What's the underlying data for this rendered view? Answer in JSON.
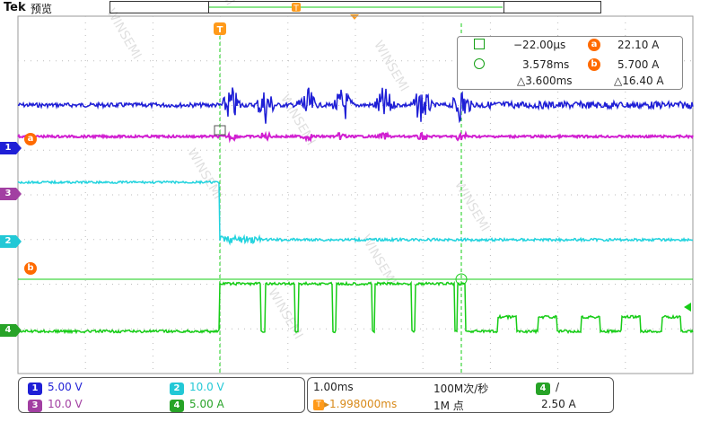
{
  "header": {
    "brand": "Tek",
    "mode": "预览",
    "trigger_marker": "T"
  },
  "colors": {
    "ch1": "#1f1fd6",
    "ch2": "#22d3de",
    "ch3": "#d11fd1",
    "ch4": "#16cc16",
    "cursor": "#ff6a00",
    "graticule": "#c8c8c8"
  },
  "channel_markers": [
    {
      "label": "1",
      "color": "#1f1fd6"
    },
    {
      "label": "3",
      "color": "#a23fa2"
    },
    {
      "label": "2",
      "color": "#22c8d6"
    },
    {
      "label": "4",
      "color": "#27a327"
    }
  ],
  "cursor_labels": {
    "a": "a",
    "b": "b"
  },
  "readout": {
    "cursor1_time": "−22.00μs",
    "cursor1_value_label": "a",
    "cursor1_value": "22.10 A",
    "cursor2_time": "3.578ms",
    "cursor2_value_label": "b",
    "cursor2_value": "5.700 A",
    "delta_time": "△3.600ms",
    "delta_value": "△16.40 A"
  },
  "bottom": {
    "ch1_label": "1",
    "ch1_scale": "5.00 V",
    "ch3_label": "3",
    "ch3_scale": "10.0 V",
    "ch2_label": "2",
    "ch2_scale": "10.0 V",
    "ch4_label": "4",
    "ch4_scale": "5.00 A",
    "timebase": "1.00ms",
    "sample_rate": "100M次/秒",
    "trigger_position": "▸1.998000ms",
    "record_length": "1M 点",
    "trigger_source": "4",
    "trigger_slope": "/",
    "trigger_level": "2.50 A"
  }
}
